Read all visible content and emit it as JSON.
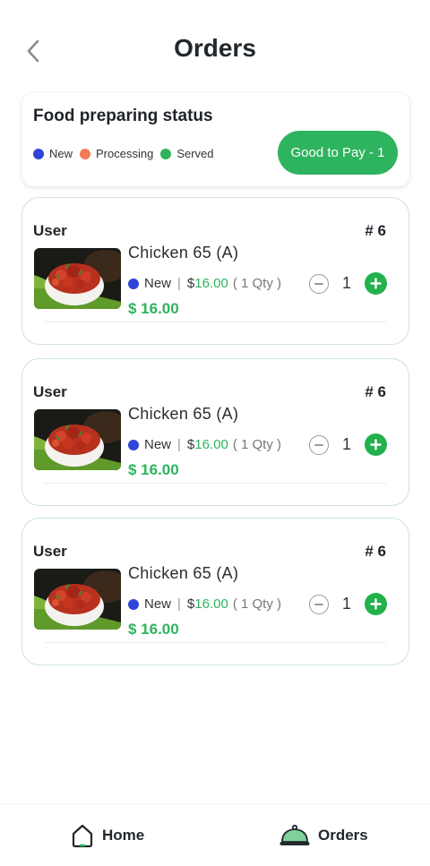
{
  "header": {
    "title": "Orders",
    "back_icon": "chevron-left-icon"
  },
  "status_card": {
    "title": "Food preparing status",
    "legend": [
      {
        "label": "New",
        "color": "#2f45d6"
      },
      {
        "label": "Processing",
        "color": "#f47a55"
      },
      {
        "label": "Served",
        "color": "#2eb35f"
      }
    ],
    "pay_button_label": "Good to Pay - 1"
  },
  "orders": [
    {
      "user": "User",
      "number": "# 6",
      "item_name": "Chicken 65 (A)",
      "status": "New",
      "status_color": "#2f45d6",
      "price_symbol": "$",
      "price": "16.00",
      "qty_label": "( 1 Qty )",
      "total": "$ 16.00",
      "quantity": "1"
    },
    {
      "user": "User",
      "number": "# 6",
      "item_name": "Chicken 65 (A)",
      "status": "New",
      "status_color": "#2f45d6",
      "price_symbol": "$",
      "price": "16.00",
      "qty_label": "( 1 Qty )",
      "total": "$ 16.00",
      "quantity": "1"
    },
    {
      "user": "User",
      "number": "# 6",
      "item_name": "Chicken 65 (A)",
      "status": "New",
      "status_color": "#2f45d6",
      "price_symbol": "$",
      "price": "16.00",
      "qty_label": "( 1 Qty )",
      "total": "$ 16.00",
      "quantity": "1"
    }
  ],
  "bottom_nav": {
    "home_label": "Home",
    "home_icon": "home-icon",
    "orders_label": "Orders",
    "orders_icon": "food-cloche-icon"
  },
  "colors": {
    "accent": "#2eb35f",
    "plus": "#22b14c",
    "new_status": "#2f45d6",
    "processing_status": "#f47a55"
  }
}
